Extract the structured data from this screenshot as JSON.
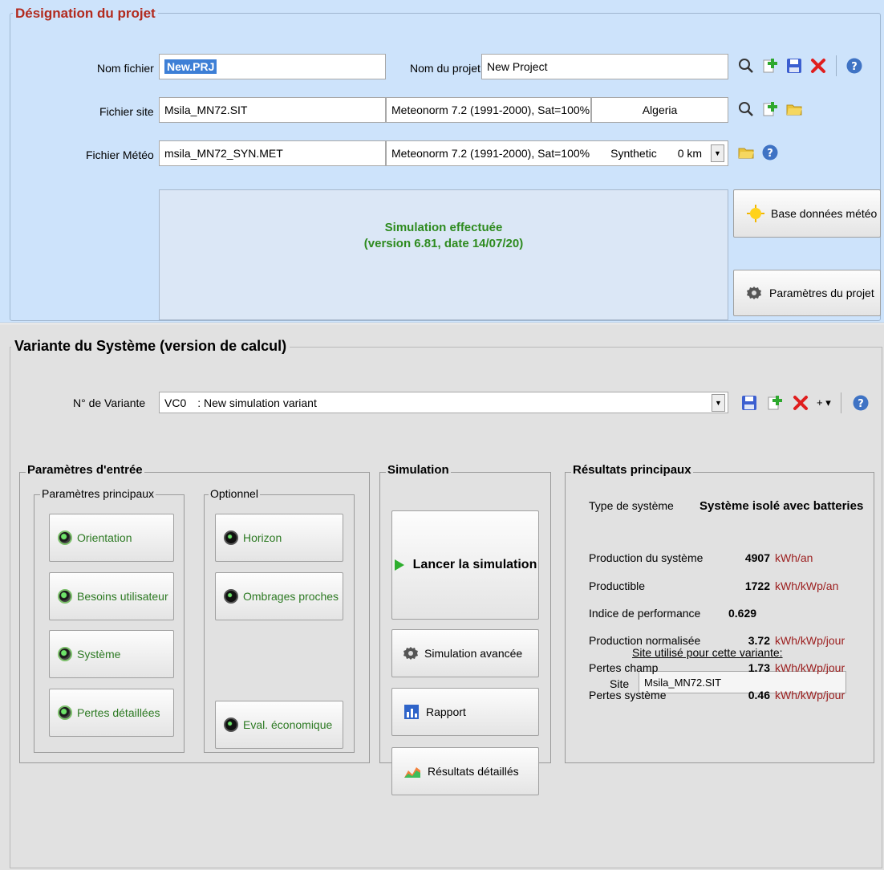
{
  "project": {
    "title": "Désignation du projet",
    "file_label": "Nom fichier",
    "file_value": "New.PRJ",
    "project_name_label": "Nom du projet",
    "project_name_value": "New Project",
    "site_label": "Fichier site",
    "site_value": "Msila_MN72.SIT",
    "site_source": "Meteonorm 7.2 (1991-2000), Sat=100%",
    "site_country": "Algeria",
    "meteo_label": "Fichier Météo",
    "meteo_value": "msila_MN72_SYN.MET",
    "meteo_source": "Meteonorm 7.2 (1991-2000), Sat=100%",
    "meteo_type": "Synthetic",
    "meteo_distance": "0 km",
    "sim_status_line1": "Simulation effectuée",
    "sim_status_line2": "(version 6.81, date 14/07/20)",
    "btn_meteo_db": "Base données météo",
    "btn_project_params": "Paramètres du projet"
  },
  "variant": {
    "title": "Variante du Système (version de calcul)",
    "number_label": "N° de Variante",
    "number_value": "VC0",
    "name_value": ": New simulation variant",
    "plus_menu": "+ ▾"
  },
  "inputs": {
    "title": "Paramètres d'entrée",
    "main_title": "Paramètres principaux",
    "optional_title": "Optionnel",
    "main_buttons": [
      "Orientation",
      "Besoins utilisateur",
      "Système",
      "Pertes détaillées"
    ],
    "optional_buttons": [
      "Horizon",
      "Ombrages proches",
      "Eval. économique"
    ]
  },
  "simulation": {
    "title": "Simulation",
    "run": "Lancer la simulation",
    "advanced": "Simulation avancée",
    "report": "Rapport",
    "detailed": "Résultats détaillés"
  },
  "results": {
    "title": "Résultats principaux",
    "system_type_label": "Type de système",
    "system_type_value": "Système isolé avec batteries",
    "rows": [
      {
        "label": "Production du système",
        "value": "4907",
        "unit": "kWh/an"
      },
      {
        "label": "Productible",
        "value": "1722",
        "unit": "kWh/kWp/an"
      },
      {
        "label": "Indice de performance",
        "value": "0.629",
        "unit": ""
      },
      {
        "label": "Production normalisée",
        "value": "3.72",
        "unit": "kWh/kWp/jour"
      },
      {
        "label": "Pertes champ",
        "value": "1.73",
        "unit": "kWh/kWp/jour"
      },
      {
        "label": "Pertes système",
        "value": "0.46",
        "unit": "kWh/kWp/jour"
      }
    ],
    "site_heading": "Site utilisé pour cette variante:",
    "site_label": "Site",
    "site_value": "Msila_MN72.SIT"
  },
  "colors": {
    "project_bg": "#cde3fb",
    "variant_bg": "#e1e1e1",
    "title_red": "#b22a1e",
    "ok_green": "#2e8b1f",
    "unit_red": "#9b1d1d"
  },
  "icons": {
    "search": "search-icon",
    "add": "add-icon",
    "save": "save-icon",
    "delete": "delete-icon",
    "help": "help-icon",
    "folder": "folder-icon",
    "sun": "sun-icon",
    "gear": "gear-icon",
    "play": "play-icon",
    "report": "report-icon",
    "chart": "chart-icon"
  }
}
